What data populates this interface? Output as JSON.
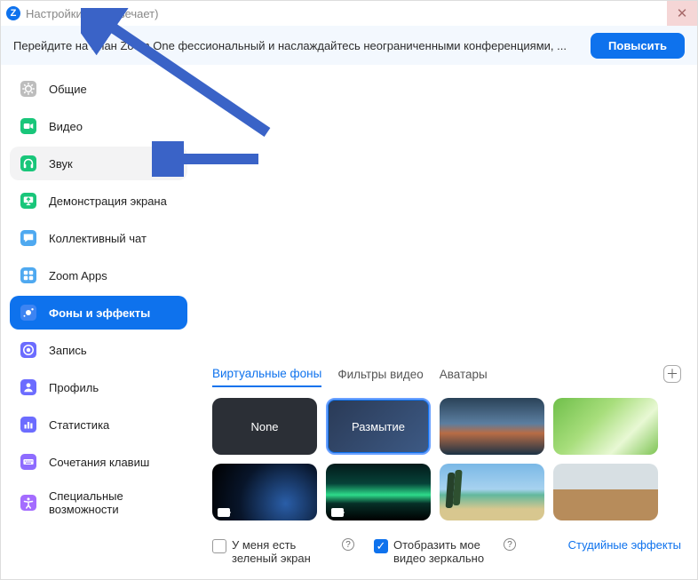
{
  "title": "Настройки (Не отвечает)",
  "banner": {
    "text": "Перейдите на план Zoom One         фессиональный и наслаждайтесь неограниченными конференциями, ...",
    "button": "Повысить"
  },
  "sidebar": {
    "items": [
      {
        "label": "Общие",
        "icon": "gear",
        "iconColor": "#bdbdbd"
      },
      {
        "label": "Видео",
        "icon": "camera",
        "iconColor": "#19c67a"
      },
      {
        "label": "Звук",
        "icon": "headphones",
        "iconColor": "#19c67a",
        "activeHover": true
      },
      {
        "label": "Демонстрация экрана",
        "icon": "screen",
        "iconColor": "#19c67a"
      },
      {
        "label": "Коллективный чат",
        "icon": "chat",
        "iconColor": "#4fa9f0"
      },
      {
        "label": "Zoom Apps",
        "icon": "apps",
        "iconColor": "#4fa9f0"
      },
      {
        "label": "Фоны и эффекты",
        "icon": "sparkle",
        "iconColor": "#2f6df0",
        "selected": true
      },
      {
        "label": "Запись",
        "icon": "record",
        "iconColor": "#6c6cff"
      },
      {
        "label": "Профиль",
        "icon": "profile",
        "iconColor": "#6c6cff"
      },
      {
        "label": "Статистика",
        "icon": "stats",
        "iconColor": "#6c6cff"
      },
      {
        "label": "Сочетания клавиш",
        "icon": "keyboard",
        "iconColor": "#8e6cff"
      },
      {
        "label": "Специальные возможности",
        "icon": "accessibility",
        "iconColor": "#a46cff"
      }
    ]
  },
  "tabs": {
    "items": [
      "Виртуальные фоны",
      "Фильтры видео",
      "Аватары"
    ],
    "active": 0
  },
  "backgrounds": {
    "none_label": "None",
    "blur_label": "Размытие"
  },
  "options": {
    "green_screen": "У меня есть зеленый экран",
    "mirror": "Отобразить мое видео зеркально",
    "studio_link": "Студийные эффекты"
  }
}
